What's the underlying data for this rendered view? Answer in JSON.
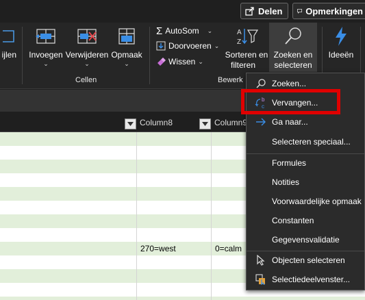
{
  "topbar": {
    "share_label": "Delen",
    "comments_label": "Opmerkingen"
  },
  "ribbon": {
    "partial_left_label": "ijlen",
    "cellen": {
      "insert_label": "Invoegen",
      "delete_label": "Verwijderen",
      "format_label": "Opmaak",
      "group_label": "Cellen"
    },
    "bewerken": {
      "autosum_label": "AutoSom",
      "fill_label": "Doorvoeren",
      "clear_label": "Wissen",
      "sort_filter_label_1": "Sorteren en",
      "sort_filter_label_2": "filteren",
      "find_select_label_1": "Zoeken en",
      "find_select_label_2": "selecteren",
      "group_label": "Bewerk"
    },
    "ideas_label": "Ideeën"
  },
  "sheet": {
    "col8_header": "Column8",
    "col9_header": "Column9",
    "cell_col8": "270=west",
    "cell_col9": "0=calm"
  },
  "menu": {
    "items": [
      {
        "label": "Zoeken...",
        "icon": "search-icon"
      },
      {
        "label": "Vervangen...",
        "icon": "replace-icon"
      },
      {
        "label": "Ga naar...",
        "icon": "arrow-right-icon"
      },
      {
        "label": "Selecteren speciaal..."
      },
      {
        "label": "Formules"
      },
      {
        "label": "Notities"
      },
      {
        "label": "Voorwaardelijke opmaak"
      },
      {
        "label": "Constanten"
      },
      {
        "label": "Gegevensvalidatie"
      },
      {
        "label": "Objecten selecteren",
        "icon": "pointer-icon"
      },
      {
        "label": "Selectiedeelvenster...",
        "icon": "selection-pane-icon"
      }
    ]
  },
  "colors": {
    "accent_blue": "#3a8ee6",
    "highlight_red": "#e00000",
    "band_green": "#e2efda"
  }
}
